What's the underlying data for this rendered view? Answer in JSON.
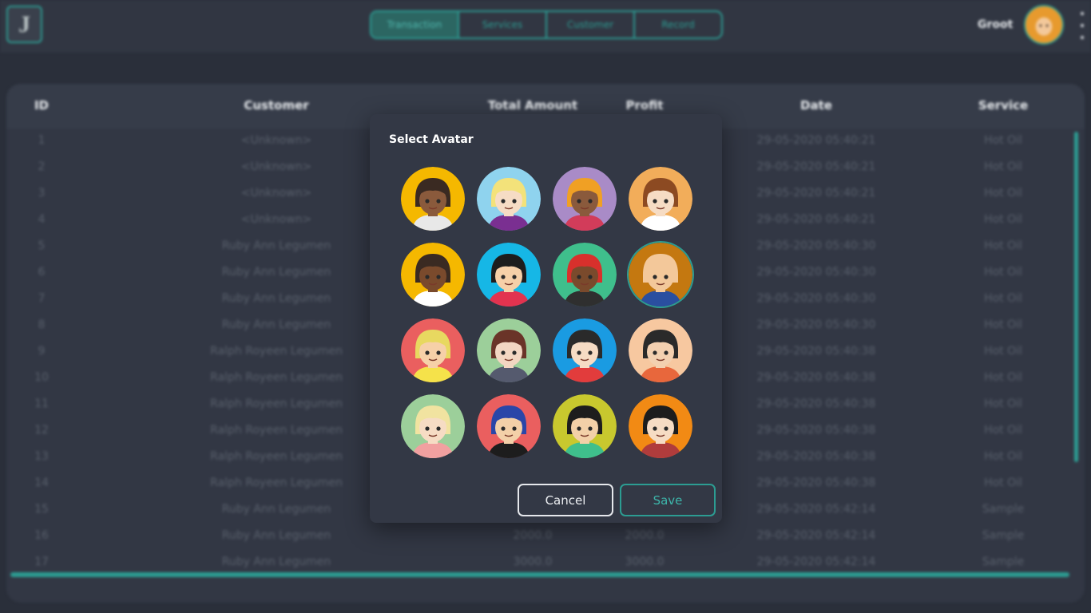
{
  "header": {
    "logo_letter": "J",
    "tabs": [
      {
        "label": "Transaction",
        "active": true
      },
      {
        "label": "Services",
        "active": false
      },
      {
        "label": "Customer",
        "active": false
      },
      {
        "label": "Record",
        "active": false
      }
    ],
    "username": "Groot",
    "menu_icon": "kebab-menu-icon"
  },
  "table": {
    "columns": [
      "ID",
      "Customer",
      "Total Amount",
      "Profit",
      "Date",
      "Service"
    ],
    "rows": [
      {
        "id": "1",
        "customer": "<Unknown>",
        "total": "",
        "profit": "",
        "date": "29-05-2020 05:40:21",
        "service": "Hot Oil"
      },
      {
        "id": "2",
        "customer": "<Unknown>",
        "total": "",
        "profit": "",
        "date": "29-05-2020 05:40:21",
        "service": "Hot Oil"
      },
      {
        "id": "3",
        "customer": "<Unknown>",
        "total": "",
        "profit": "",
        "date": "29-05-2020 05:40:21",
        "service": "Hot Oil"
      },
      {
        "id": "4",
        "customer": "<Unknown>",
        "total": "",
        "profit": "",
        "date": "29-05-2020 05:40:21",
        "service": "Hot Oil"
      },
      {
        "id": "5",
        "customer": "Ruby Ann Legumen",
        "total": "",
        "profit": "",
        "date": "29-05-2020 05:40:30",
        "service": "Hot Oil"
      },
      {
        "id": "6",
        "customer": "Ruby Ann Legumen",
        "total": "",
        "profit": "",
        "date": "29-05-2020 05:40:30",
        "service": "Hot Oil"
      },
      {
        "id": "7",
        "customer": "Ruby Ann Legumen",
        "total": "",
        "profit": "",
        "date": "29-05-2020 05:40:30",
        "service": "Hot Oil"
      },
      {
        "id": "8",
        "customer": "Ruby Ann Legumen",
        "total": "",
        "profit": "",
        "date": "29-05-2020 05:40:30",
        "service": "Hot Oil"
      },
      {
        "id": "9",
        "customer": "Ralph Royeen Legumen",
        "total": "",
        "profit": "",
        "date": "29-05-2020 05:40:38",
        "service": "Hot Oil"
      },
      {
        "id": "10",
        "customer": "Ralph Royeen Legumen",
        "total": "",
        "profit": "",
        "date": "29-05-2020 05:40:38",
        "service": "Hot Oil"
      },
      {
        "id": "11",
        "customer": "Ralph Royeen Legumen",
        "total": "",
        "profit": "",
        "date": "29-05-2020 05:40:38",
        "service": "Hot Oil"
      },
      {
        "id": "12",
        "customer": "Ralph Royeen Legumen",
        "total": "",
        "profit": "",
        "date": "29-05-2020 05:40:38",
        "service": "Hot Oil"
      },
      {
        "id": "13",
        "customer": "Ralph Royeen Legumen",
        "total": "",
        "profit": "",
        "date": "29-05-2020 05:40:38",
        "service": "Hot Oil"
      },
      {
        "id": "14",
        "customer": "Ralph Royeen Legumen",
        "total": "",
        "profit": "",
        "date": "29-05-2020 05:40:38",
        "service": "Hot Oil"
      },
      {
        "id": "15",
        "customer": "Ruby Ann Legumen",
        "total": "",
        "profit": "",
        "date": "29-05-2020 05:42:14",
        "service": "Sample"
      },
      {
        "id": "16",
        "customer": "Ruby Ann Legumen",
        "total": "2000.0",
        "profit": "2000.0",
        "date": "29-05-2020 05:42:14",
        "service": "Sample"
      },
      {
        "id": "17",
        "customer": "Ruby Ann Legumen",
        "total": "3000.0",
        "profit": "3000.0",
        "date": "29-05-2020 05:42:14",
        "service": "Sample"
      }
    ]
  },
  "dialog": {
    "title": "Select Avatar",
    "cancel_label": "Cancel",
    "save_label": "Save",
    "selected_index": 7,
    "avatars": [
      {
        "name": "avatar-girl-curly-dark",
        "bg": "#f5b800",
        "skin": "#8a5a3c",
        "hair": "#3a2a22",
        "shirt": "#e8e8e8"
      },
      {
        "name": "avatar-girl-blonde-bows",
        "bg": "#8fd3ee",
        "skin": "#f6dcc4",
        "hair": "#f3e27a",
        "shirt": "#7a2f91"
      },
      {
        "name": "avatar-girl-orange-headwrap",
        "bg": "#a98bc7",
        "skin": "#8a5a3c",
        "hair": "#f0a024",
        "shirt": "#d23c5a"
      },
      {
        "name": "avatar-girl-brown-braid",
        "bg": "#f2ad5a",
        "skin": "#f6dcc4",
        "hair": "#8c4a22",
        "shirt": "#ffffff"
      },
      {
        "name": "avatar-boy-dark-short",
        "bg": "#f5b800",
        "skin": "#7a4a2c",
        "hair": "#3a2a22",
        "shirt": "#ffffff"
      },
      {
        "name": "avatar-boy-curly-glasses",
        "bg": "#16b7e6",
        "skin": "#f6d0a8",
        "hair": "#1d1d1d",
        "shirt": "#e2334f"
      },
      {
        "name": "avatar-boy-red-beanie",
        "bg": "#3fbf8c",
        "skin": "#7a4a2c",
        "hair": "#d8302c",
        "shirt": "#2f2f2f"
      },
      {
        "name": "avatar-boy-bald",
        "bg": "#c47810",
        "skin": "#f3c89a",
        "hair": "#f3c89a",
        "shirt": "#2a4fa0"
      },
      {
        "name": "avatar-boy-red-cap",
        "bg": "#ea5f5f",
        "skin": "#f6d0a8",
        "hair": "#e8d860",
        "shirt": "#f5e24a"
      },
      {
        "name": "avatar-girl-brown-hair",
        "bg": "#9ccf9a",
        "skin": "#f3d6c2",
        "hair": "#6a3428",
        "shirt": "#555a6e"
      },
      {
        "name": "avatar-girl-black-glasses",
        "bg": "#1a9be2",
        "skin": "#f6dcc4",
        "hair": "#2a2a2a",
        "shirt": "#e23c3c"
      },
      {
        "name": "avatar-girl-black-braid",
        "bg": "#f7c8a0",
        "skin": "#f3d0b0",
        "hair": "#2a2a2a",
        "shirt": "#e8673c"
      },
      {
        "name": "avatar-boy-blonde",
        "bg": "#9ccf9a",
        "skin": "#f6dcc4",
        "hair": "#f1e3a0",
        "shirt": "#f1a0a0"
      },
      {
        "name": "avatar-boy-blue-cap",
        "bg": "#ea5f5f",
        "skin": "#f3d0a8",
        "hair": "#2a46a8",
        "shirt": "#1d1d1d"
      },
      {
        "name": "avatar-boy-black-hair",
        "bg": "#c8c82e",
        "skin": "#f3d0a8",
        "hair": "#1d1d1d",
        "shirt": "#3fbf8c"
      },
      {
        "name": "avatar-girl-glasses-bob",
        "bg": "#f28a14",
        "skin": "#f6dcc4",
        "hair": "#1d1d1d",
        "shirt": "#b03c3c"
      }
    ]
  }
}
